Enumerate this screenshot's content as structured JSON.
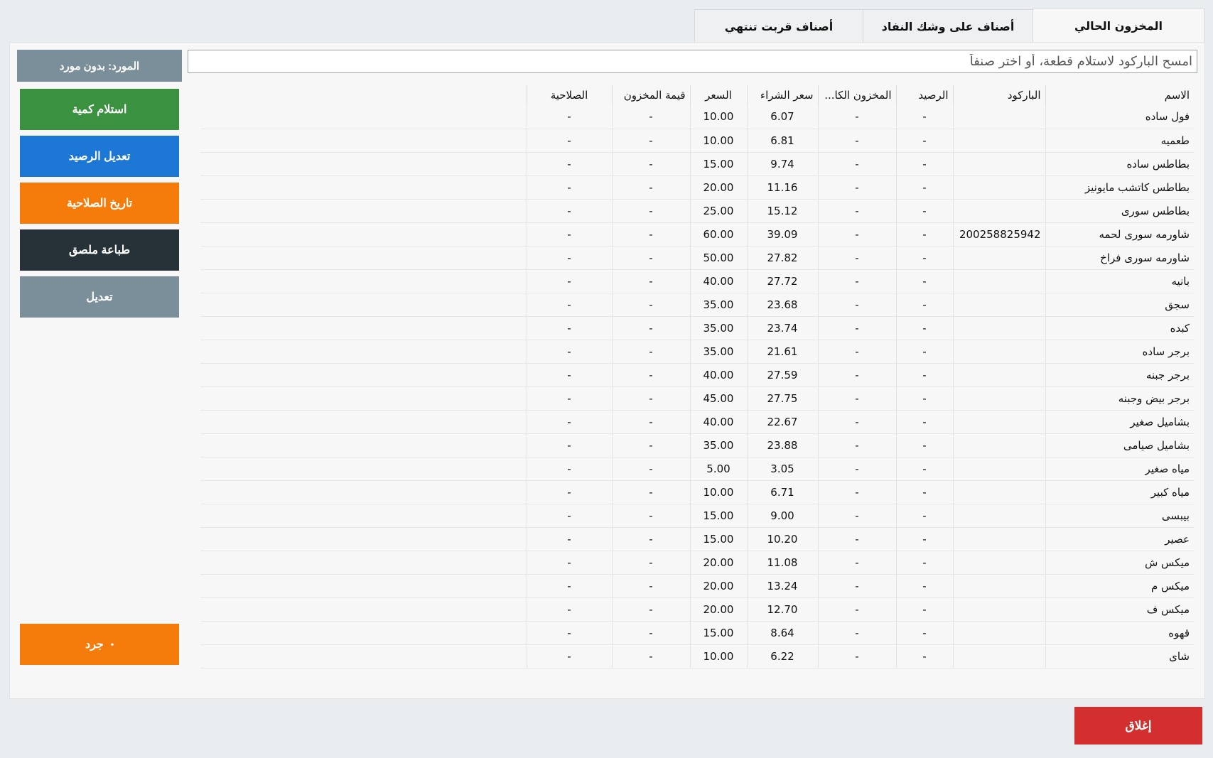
{
  "tabs": {
    "current": "المخزون الحالي",
    "low": "أصناف على وشك النفاد",
    "expiring": "أصناف قربت تنتهي"
  },
  "sidebar": {
    "supplier": "المورد: بدون مورد",
    "receive": "استلام كمية",
    "adjust": "تعديل الرصيد",
    "expiry": "تاريخ الصلاحية",
    "print_label": "طباعة ملصق",
    "edit": "تعديل",
    "count": "جرد",
    "count_dot": "•"
  },
  "search": {
    "placeholder": "امسح الباركود لاستلام قطعة، أو اختر صنفاً"
  },
  "table": {
    "headers": {
      "name": "الاسم",
      "barcode": "الباركود",
      "balance": "الرصيد",
      "stock": "المخزون الكا...",
      "buy_price": "سعر الشراء",
      "price": "السعر",
      "stock_value": "قيمة المخزون",
      "expiry": "الصلاحية"
    },
    "rows": [
      {
        "name": "فول ساده",
        "barcode": "",
        "balance": "-",
        "stock": "-",
        "buy": "6.07",
        "price": "10.00",
        "value": "-",
        "expiry": "-"
      },
      {
        "name": "طعميه",
        "barcode": "",
        "balance": "-",
        "stock": "-",
        "buy": "6.81",
        "price": "10.00",
        "value": "-",
        "expiry": "-"
      },
      {
        "name": "بطاطس ساده",
        "barcode": "",
        "balance": "-",
        "stock": "-",
        "buy": "9.74",
        "price": "15.00",
        "value": "-",
        "expiry": "-"
      },
      {
        "name": "بطاطس كاتشب مايونيز",
        "barcode": "",
        "balance": "-",
        "stock": "-",
        "buy": "11.16",
        "price": "20.00",
        "value": "-",
        "expiry": "-"
      },
      {
        "name": "بطاطس سورى",
        "barcode": "",
        "balance": "-",
        "stock": "-",
        "buy": "15.12",
        "price": "25.00",
        "value": "-",
        "expiry": "-"
      },
      {
        "name": "شاورمه سورى لحمه",
        "barcode": "200258825942",
        "balance": "-",
        "stock": "-",
        "buy": "39.09",
        "price": "60.00",
        "value": "-",
        "expiry": "-"
      },
      {
        "name": "شاورمه سورى فراخ",
        "barcode": "",
        "balance": "-",
        "stock": "-",
        "buy": "27.82",
        "price": "50.00",
        "value": "-",
        "expiry": "-"
      },
      {
        "name": "بانيه",
        "barcode": "",
        "balance": "-",
        "stock": "-",
        "buy": "27.72",
        "price": "40.00",
        "value": "-",
        "expiry": "-"
      },
      {
        "name": "سجق",
        "barcode": "",
        "balance": "-",
        "stock": "-",
        "buy": "23.68",
        "price": "35.00",
        "value": "-",
        "expiry": "-"
      },
      {
        "name": "كبده",
        "barcode": "",
        "balance": "-",
        "stock": "-",
        "buy": "23.74",
        "price": "35.00",
        "value": "-",
        "expiry": "-"
      },
      {
        "name": "برجر ساده",
        "barcode": "",
        "balance": "-",
        "stock": "-",
        "buy": "21.61",
        "price": "35.00",
        "value": "-",
        "expiry": "-"
      },
      {
        "name": "برجر جبنه",
        "barcode": "",
        "balance": "-",
        "stock": "-",
        "buy": "27.59",
        "price": "40.00",
        "value": "-",
        "expiry": "-"
      },
      {
        "name": "برجر بيض وجبنه",
        "barcode": "",
        "balance": "-",
        "stock": "-",
        "buy": "27.75",
        "price": "45.00",
        "value": "-",
        "expiry": "-"
      },
      {
        "name": "بشاميل صغير",
        "barcode": "",
        "balance": "-",
        "stock": "-",
        "buy": "22.67",
        "price": "40.00",
        "value": "-",
        "expiry": "-"
      },
      {
        "name": "بشاميل صيامى",
        "barcode": "",
        "balance": "-",
        "stock": "-",
        "buy": "23.88",
        "price": "35.00",
        "value": "-",
        "expiry": "-"
      },
      {
        "name": "مياه صغير",
        "barcode": "",
        "balance": "-",
        "stock": "-",
        "buy": "3.05",
        "price": "5.00",
        "value": "-",
        "expiry": "-"
      },
      {
        "name": "مياه كبير",
        "barcode": "",
        "balance": "-",
        "stock": "-",
        "buy": "6.71",
        "price": "10.00",
        "value": "-",
        "expiry": "-"
      },
      {
        "name": "بيبسى",
        "barcode": "",
        "balance": "-",
        "stock": "-",
        "buy": "9.00",
        "price": "15.00",
        "value": "-",
        "expiry": "-"
      },
      {
        "name": "عصير",
        "barcode": "",
        "balance": "-",
        "stock": "-",
        "buy": "10.20",
        "price": "15.00",
        "value": "-",
        "expiry": "-"
      },
      {
        "name": "ميكس ش",
        "barcode": "",
        "balance": "-",
        "stock": "-",
        "buy": "11.08",
        "price": "20.00",
        "value": "-",
        "expiry": "-"
      },
      {
        "name": "ميكس م",
        "barcode": "",
        "balance": "-",
        "stock": "-",
        "buy": "13.24",
        "price": "20.00",
        "value": "-",
        "expiry": "-"
      },
      {
        "name": "ميكس ف",
        "barcode": "",
        "balance": "-",
        "stock": "-",
        "buy": "12.70",
        "price": "20.00",
        "value": "-",
        "expiry": "-"
      },
      {
        "name": "قهوه",
        "barcode": "",
        "balance": "-",
        "stock": "-",
        "buy": "8.64",
        "price": "15.00",
        "value": "-",
        "expiry": "-"
      },
      {
        "name": "شاى",
        "barcode": "",
        "balance": "-",
        "stock": "-",
        "buy": "6.22",
        "price": "10.00",
        "value": "-",
        "expiry": "-"
      }
    ]
  },
  "footer": {
    "close": "إغلاق"
  },
  "colors": {
    "receive": "#3a9240",
    "adjust": "#1c78d4",
    "expiry": "#f57c0a",
    "print_label": "#263238",
    "edit": "#7b8f9b",
    "count": "#f57c0a",
    "close": "#d32f2f"
  }
}
